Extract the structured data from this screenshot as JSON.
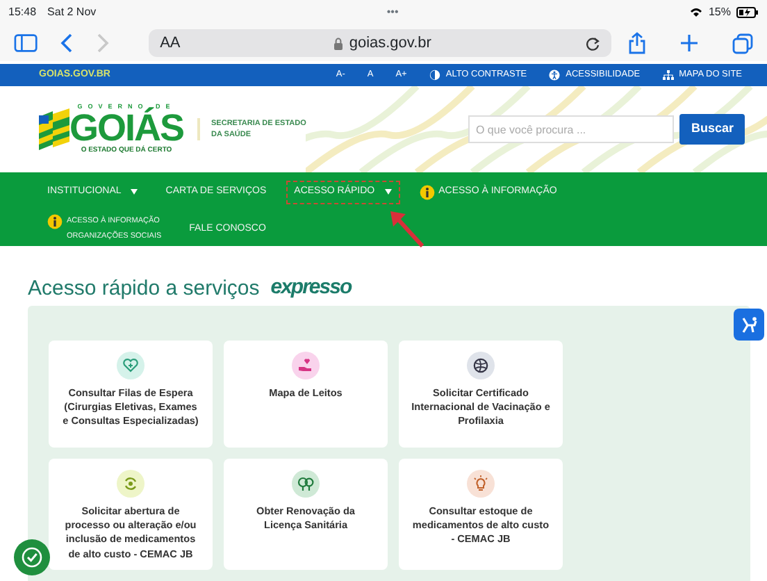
{
  "status_bar": {
    "time": "15:48",
    "date": "Sat 2 Nov",
    "dots": "•••",
    "battery": "15%"
  },
  "browser": {
    "text_size": "AA",
    "url": "goias.gov.br",
    "can_go_forward": false
  },
  "top_bar": {
    "site": "GOIAS.GOV.BR",
    "font_sizes": [
      "A-",
      "A",
      "A+"
    ],
    "links": [
      {
        "label": "ALTO CONTRASTE",
        "kind": "contrast"
      },
      {
        "label": "ACESSIBILIDADE",
        "kind": "accessibility"
      },
      {
        "label": "MAPA DO SITE",
        "kind": "sitemap"
      }
    ]
  },
  "header": {
    "logo_top": "GOVERNO DE",
    "logo_name": "GOIÁS",
    "logo_slogan": "O ESTADO QUE DÁ CERTO",
    "secretariat": "SECRETARIA DE ESTADO DA SAÚDE",
    "search": {
      "placeholder": "O que você procura ..."
    },
    "search_button": "Buscar"
  },
  "nav": {
    "rows": [
      [
        {
          "lines": [
            "INSTITUCIONAL"
          ],
          "dropdown": true,
          "info": false,
          "annotated": false
        },
        {
          "lines": [
            "CARTA DE SERVIÇOS"
          ],
          "dropdown": false,
          "info": false,
          "annotated": false
        },
        {
          "lines": [
            "ACESSO RÁPIDO"
          ],
          "dropdown": true,
          "info": false,
          "annotated": true
        },
        {
          "lines": [
            "ACESSO À INFORMAÇÃO"
          ],
          "dropdown": false,
          "info": true,
          "annotated": false
        }
      ],
      [
        {
          "lines": [
            "ACESSO À INFORMAÇÃO",
            "ORGANIZAÇÕES SOCIAIS"
          ],
          "dropdown": false,
          "info": true,
          "annotated": false
        },
        {
          "lines": [
            "FALE CONOSCO"
          ],
          "dropdown": false,
          "info": false,
          "annotated": false
        }
      ]
    ]
  },
  "section": {
    "title": "Acesso rápido a serviços",
    "brand": "expresso",
    "cards": [
      {
        "label": "Consultar Filas de Espera (Cirurgias Eletivas, Exames e Consultas Especializadas)",
        "kind": "heart",
        "color": "#d5f2ea"
      },
      {
        "label": "Mapa de Leitos",
        "kind": "hand-heart",
        "color": "#f9d3ec"
      },
      {
        "label": "Solicitar Certificado Internacional de Vacinação e Profilaxia",
        "kind": "globe",
        "color": "#dfe3ea"
      },
      {
        "label": "Solicitar abertura de processo ou alteração e/ou inclusão de medicamentos de alto custo - CEMAC JB",
        "kind": "refresh",
        "color": "#eef5c8"
      },
      {
        "label": "Obter Renovação da Licença Sanitária",
        "kind": "trees",
        "color": "#cfe9d6"
      },
      {
        "label": "Consultar estoque de medicamentos de alto custo - CEMAC JB",
        "kind": "bulb",
        "color": "#f8e1d6"
      }
    ]
  }
}
